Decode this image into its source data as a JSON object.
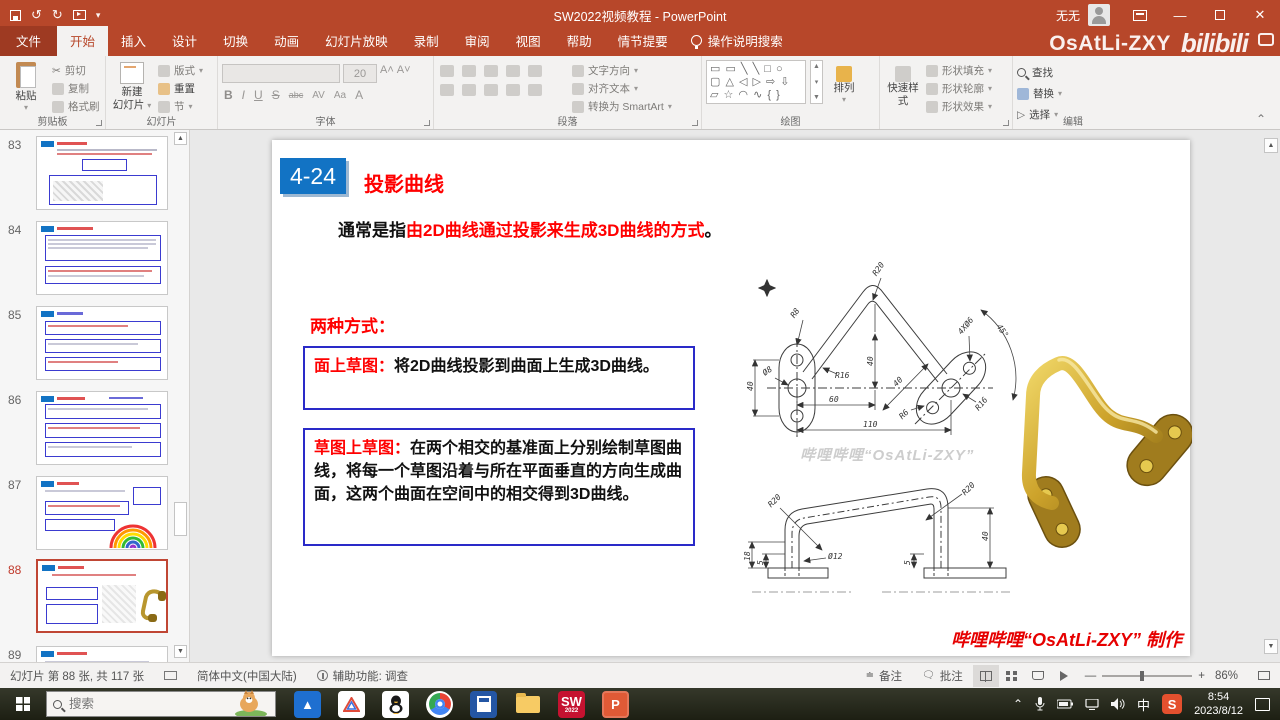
{
  "title_bar": {
    "title": "SW2022视频教程  -  PowerPoint",
    "user": "无无",
    "watermark_name": "OsAtLi-ZXY",
    "watermark_logo": "bilibili"
  },
  "tabs": [
    {
      "label": "文件"
    },
    {
      "label": "开始"
    },
    {
      "label": "插入"
    },
    {
      "label": "设计"
    },
    {
      "label": "切换"
    },
    {
      "label": "动画"
    },
    {
      "label": "幻灯片放映"
    },
    {
      "label": "录制"
    },
    {
      "label": "审阅"
    },
    {
      "label": "视图"
    },
    {
      "label": "帮助"
    },
    {
      "label": "情节提要"
    }
  ],
  "tell_me": "操作说明搜索",
  "ribbon": {
    "clipboard": {
      "group": "剪贴板",
      "paste": "粘贴",
      "cut": "剪切",
      "copy": "复制",
      "painter": "格式刷"
    },
    "slides": {
      "group": "幻灯片",
      "new_slide_1": "新建",
      "new_slide_2": "幻灯片",
      "layout": "版式",
      "reset": "重置",
      "section": "节"
    },
    "font": {
      "group": "字体",
      "size": "20",
      "bold": "B",
      "italic": "I",
      "underline": "U",
      "strike": "S",
      "abc": "abc",
      "av": "AV",
      "aa": "Aa",
      "a": "A"
    },
    "paragraph": {
      "group": "段落",
      "text_dir": "文字方向",
      "align_text": "对齐文本",
      "smartart": "转换为 SmartArt"
    },
    "drawing": {
      "group": "绘图",
      "arrange": "排列",
      "quick_styles": "快速样式",
      "shape_fill": "形状填充",
      "shape_outline": "形状轮廓",
      "shape_effects": "形状效果",
      "shapes_row1": "▭ ▭ ╲ ╲ □ ○",
      "shapes_row2": "▢ △ ◁ ▷ ⇨ ⇩",
      "shapes_row3": "▱ ☆ ◠ ∿ { }"
    },
    "editing": {
      "group": "编辑",
      "find": "查找",
      "replace": "替换",
      "select": "选择"
    }
  },
  "thumbnails": [
    {
      "num": "83"
    },
    {
      "num": "84"
    },
    {
      "num": "85"
    },
    {
      "num": "86"
    },
    {
      "num": "87"
    },
    {
      "num": "88"
    },
    {
      "num": "89"
    }
  ],
  "slide": {
    "badge": "4-24",
    "title": "投影曲线",
    "intro_prefix": "通常是指",
    "intro_red": "由2D曲线通过投影来生成3D曲线的方式",
    "intro_suffix": "。",
    "methods_label": "两种方式：",
    "box1_label": "面上草图：",
    "box1_text": "将2D曲线投影到曲面上生成3D曲线。",
    "box2_label": "草图上草图：",
    "box2_text": "在两个相交的基准面上分别绘制草图曲线，将每一个草图沿着与所在平面垂直的方向生成曲面，这两个曲面在空间中的相交得到3D曲线。",
    "watermark": "哔哩哔哩“OsAtLi-ZXY”",
    "credit": "哔哩哔哩“OsAtLi-ZXY”  制作"
  },
  "drawing_top_dims": {
    "r8": "R8",
    "r20": "R20",
    "left40": "40",
    "d8": "Ø8",
    "r16": "R16",
    "mid40": "40",
    "h60": "60",
    "h110": "110",
    "diag40": "40",
    "r6": "R6",
    "r16b": "R16",
    "holes": "4XØ6",
    "angle": "45°"
  },
  "drawing_front_dims": {
    "r20l": "R20",
    "r20r": "R20",
    "d12": "Ø12",
    "v18": "18",
    "v5l": "5",
    "v5r": "5",
    "v40": "40"
  },
  "status_bar": {
    "slide_info": "幻灯片 第 88 张, 共 117 张",
    "language": "简体中文(中国大陆)",
    "accessibility": "辅助功能: 调查",
    "notes": "备注",
    "comments": "批注",
    "zoom": "86%"
  },
  "taskbar": {
    "search_placeholder": "搜索",
    "sw_label": "SW",
    "sw_year": "2022",
    "pp_label": "P",
    "sogou_label": "S",
    "ime": "中",
    "time": "8:54",
    "date": "2023/8/12"
  }
}
